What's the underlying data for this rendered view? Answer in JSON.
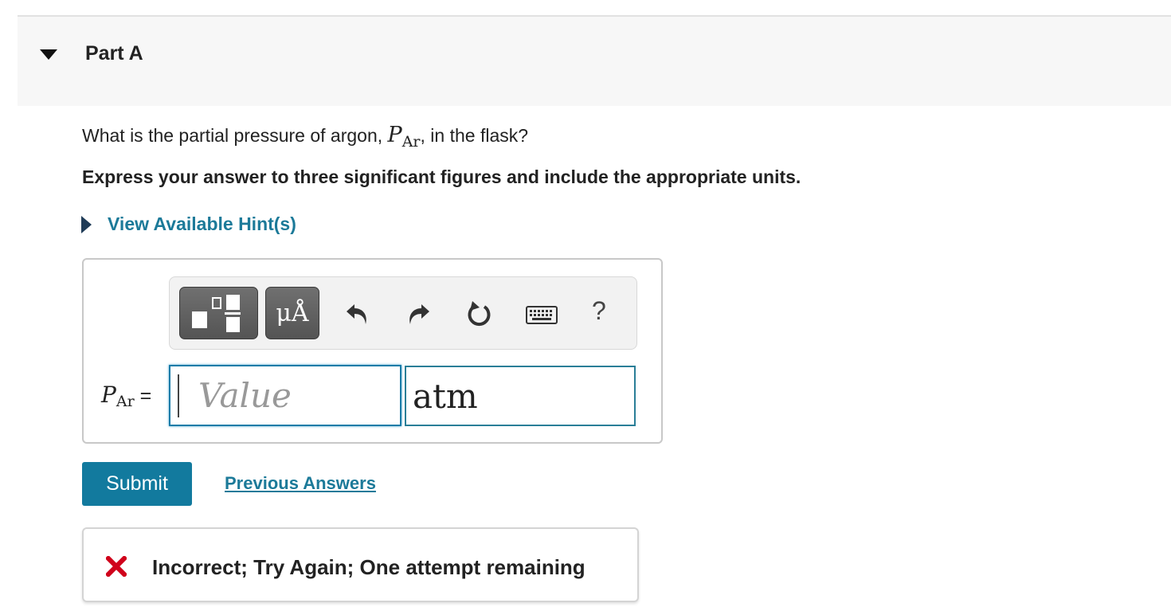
{
  "part": {
    "title": "Part A"
  },
  "question": {
    "text_before": "What is the partial pressure of argon, ",
    "symbol": "P",
    "subscript": "Ar",
    "text_after": ", in the flask?"
  },
  "instruction": "Express your answer to three significant figures and include the appropriate units.",
  "hint": {
    "label": "View Available Hint(s)"
  },
  "toolbar": {
    "units_label": "μÅ",
    "help_label": "?",
    "icons": [
      "templates-icon",
      "units-icon",
      "undo-icon",
      "redo-icon",
      "reset-icon",
      "keyboard-icon",
      "help-icon"
    ]
  },
  "answer": {
    "variable": "P",
    "variable_sub": "Ar",
    "equals": "=",
    "value_placeholder": "Value",
    "value": "",
    "unit": "atm"
  },
  "actions": {
    "submit_label": "Submit",
    "previous_answers_label": "Previous Answers"
  },
  "feedback": {
    "text": "Incorrect; Try Again; One attempt remaining",
    "status": "incorrect"
  },
  "colors": {
    "link": "#1c7a99",
    "submit_bg": "#127a9e",
    "error": "#d0021b",
    "input_focus": "#1a7ca8"
  }
}
